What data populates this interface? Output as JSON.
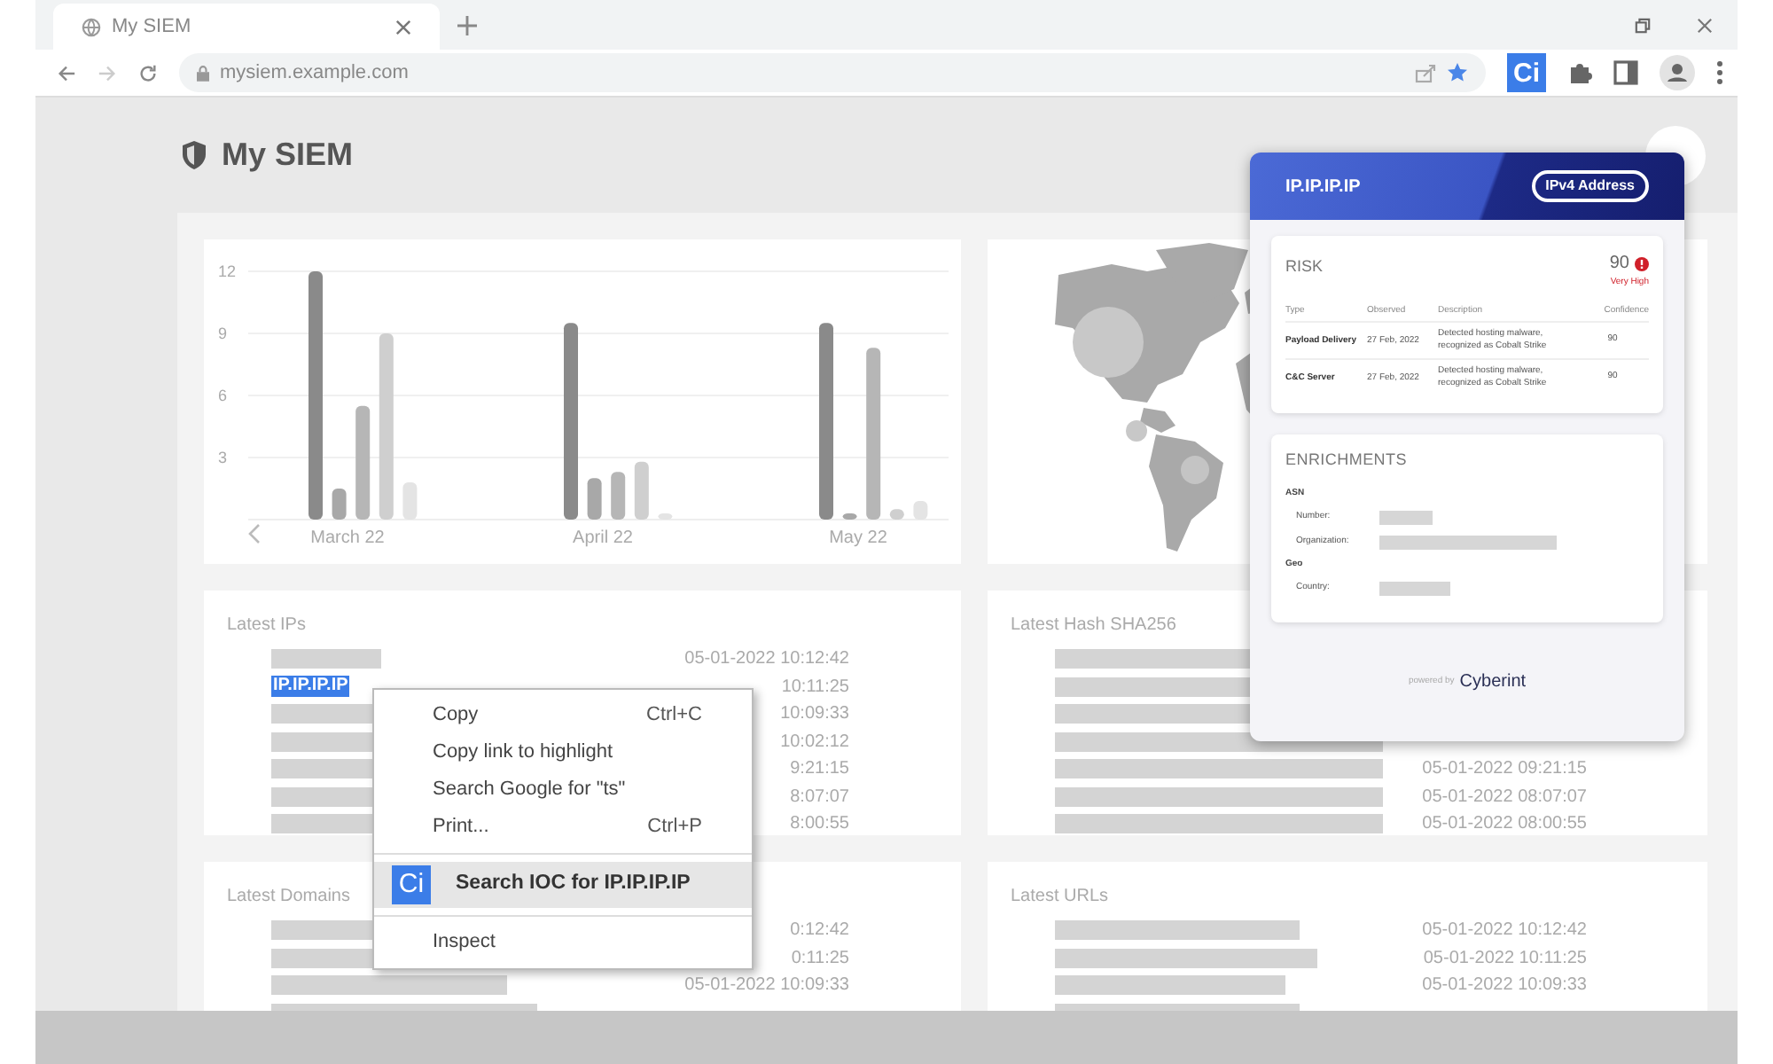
{
  "browser": {
    "tab_title": "My SIEM",
    "url": "mysiem.example.com",
    "extension_label": "Ci"
  },
  "page": {
    "title": "My SIEM",
    "chart": {
      "chart_data": {
        "type": "bar",
        "categories": [
          "March 22",
          "April 22",
          "May 22"
        ],
        "ylim": [
          0,
          12
        ],
        "grid": true,
        "yticks": [
          3,
          6,
          9,
          12
        ],
        "series": [
          {
            "color": "#8a8a8a",
            "values": [
              12,
              9.5,
              9.5
            ]
          },
          {
            "color": "#a8a8a8",
            "values": [
              1.5,
              2,
              0.3
            ]
          },
          {
            "color": "#b6b6b6",
            "values": [
              5.5,
              2.3,
              8.3
            ]
          },
          {
            "color": "#cfcfcf",
            "values": [
              9,
              2.8,
              0.5
            ]
          },
          {
            "color": "#e4e4e4",
            "values": [
              1.8,
              0.3,
              0.9
            ]
          }
        ]
      }
    },
    "lists": [
      {
        "title": "Latest IPs",
        "rows": [
          {
            "kind": "redacted",
            "timestamp": "05-01-2022 10:12:42"
          },
          {
            "kind": "text",
            "text": "IP.IP.IP.IP",
            "selected": true,
            "timestamp": "10:11:25"
          },
          {
            "kind": "redacted",
            "timestamp": "10:09:33"
          },
          {
            "kind": "redacted",
            "timestamp": "10:02:12"
          },
          {
            "kind": "redacted",
            "timestamp": "9:21:15"
          },
          {
            "kind": "redacted",
            "timestamp": "8:07:07"
          },
          {
            "kind": "redacted",
            "timestamp": "8:00:55"
          }
        ]
      },
      {
        "title": "Latest Hash SHA256",
        "rows": [
          {
            "kind": "redacted"
          },
          {
            "kind": "redacted"
          },
          {
            "kind": "redacted"
          },
          {
            "kind": "redacted"
          },
          {
            "kind": "redacted",
            "timestamp": "05-01-2022 09:21:15"
          },
          {
            "kind": "redacted",
            "timestamp": "05-01-2022 08:07:07"
          },
          {
            "kind": "redacted",
            "timestamp": "05-01-2022 08:00:55"
          }
        ]
      },
      {
        "title": "Latest Domains",
        "rows": [
          {
            "kind": "redacted",
            "timestamp": "0:12:42"
          },
          {
            "kind": "redacted",
            "timestamp": "0:11:25"
          },
          {
            "kind": "redacted",
            "timestamp": "05-01-2022 10:09:33"
          },
          {
            "kind": "redacted"
          }
        ]
      },
      {
        "title": "Latest URLs",
        "rows": [
          {
            "kind": "redacted",
            "timestamp": "05-01-2022 10:12:42"
          },
          {
            "kind": "redacted",
            "timestamp": "05-01-2022 10:11:25"
          },
          {
            "kind": "redacted",
            "timestamp": "05-01-2022 10:09:33"
          },
          {
            "kind": "redacted"
          }
        ]
      }
    ]
  },
  "popup": {
    "title": "IP.IP.IP.IP",
    "type_badge": "IPv4 Address",
    "risk": {
      "label": "RISK",
      "score": "90",
      "severity": "Very High",
      "columns": [
        "Type",
        "Observed",
        "Description",
        "Confidence"
      ],
      "rows": [
        {
          "type": "Payload Delivery",
          "observed": "27 Feb, 2022",
          "description": "Detected hosting malware, recognized as Cobalt Strike",
          "confidence": "90"
        },
        {
          "type": "C&C Server",
          "observed": "27 Feb, 2022",
          "description": "Detected hosting malware, recognized as Cobalt Strike",
          "confidence": "90"
        }
      ]
    },
    "enrichments": {
      "title": "ENRICHMENTS",
      "groups": [
        {
          "label": "ASN",
          "fields": [
            {
              "label": "Number:"
            },
            {
              "label": "Organization:"
            }
          ]
        },
        {
          "label": "Geo",
          "fields": [
            {
              "label": "Country:"
            }
          ]
        }
      ]
    },
    "footer": {
      "prefix": "powered by",
      "brand": "Cyberint"
    }
  },
  "context_menu": {
    "items": [
      {
        "kind": "item",
        "label": "Copy",
        "shortcut": "Ctrl+C",
        "selected": false
      },
      {
        "kind": "item",
        "label": "Copy link to highlight",
        "selected": false
      },
      {
        "kind": "item",
        "label": "Search Google for \"ts\"",
        "selected": false
      },
      {
        "kind": "item",
        "label": "Print...",
        "shortcut": "Ctrl+P",
        "selected": false
      },
      {
        "kind": "separator"
      },
      {
        "kind": "extension",
        "icon_label": "Ci",
        "label": "Search IOC for IP.IP.IP.IP",
        "selected": true
      },
      {
        "kind": "separator"
      },
      {
        "kind": "item",
        "label": "Inspect",
        "selected": false
      }
    ]
  }
}
